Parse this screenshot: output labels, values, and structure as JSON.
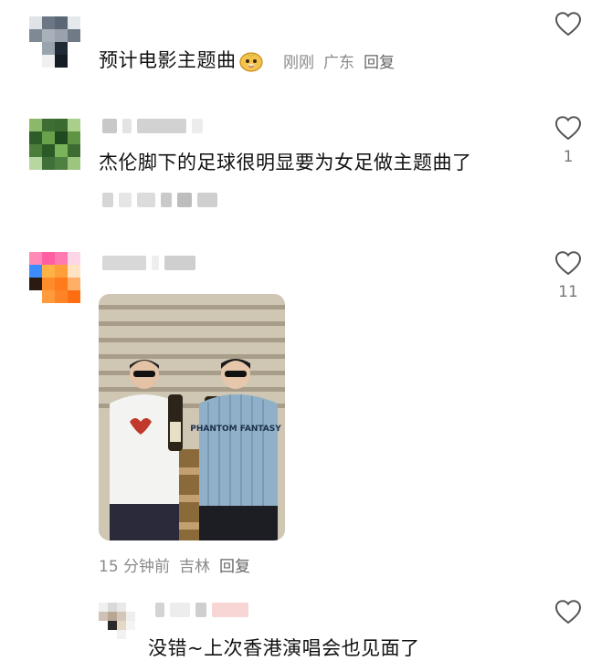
{
  "comments": [
    {
      "text": "预计电影主题曲",
      "meta": {
        "time": "刚刚",
        "location": "广东",
        "reply": "回复"
      },
      "icon": "cartoon-face-emoji"
    },
    {
      "text": "杰伦脚下的足球很明显要为女足做主题曲了",
      "likes": "1"
    },
    {
      "likes": "11",
      "meta": {
        "time": "15 分钟前",
        "location": "吉林",
        "reply": "回复"
      }
    },
    {
      "text": "没错~上次香港演唱会也见面了"
    }
  ],
  "photo_jersey_text": "PHANTOM FANTASY",
  "colors": {
    "text": "#111111",
    "meta": "#8a8a8a",
    "icon": "#555555"
  }
}
